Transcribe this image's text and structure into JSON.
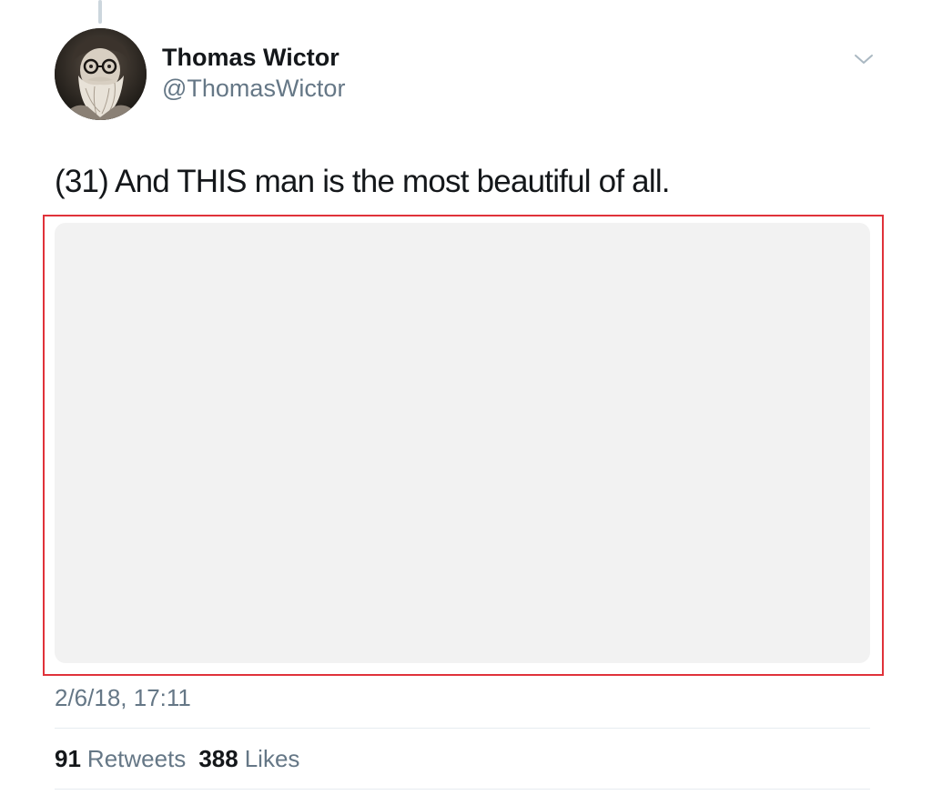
{
  "tweet": {
    "author": {
      "display_name": "Thomas Wictor",
      "handle": "@ThomasWictor"
    },
    "text": "(31) And THIS man is the most beautiful of all.",
    "timestamp": "2/6/18, 17:11",
    "stats": {
      "retweets_count": "91",
      "retweets_label": "Retweets",
      "likes_count": "388",
      "likes_label": "Likes"
    }
  },
  "icons": {
    "menu": "chevron-down-icon",
    "avatar": "avatar-illustration"
  },
  "colors": {
    "primary_text": "#14171a",
    "secondary_text": "#657786",
    "divider": "#e6ecf0",
    "media_placeholder": "#f2f2f2",
    "highlight_border": "#e0323a",
    "thread_line": "#ccd6dd"
  }
}
